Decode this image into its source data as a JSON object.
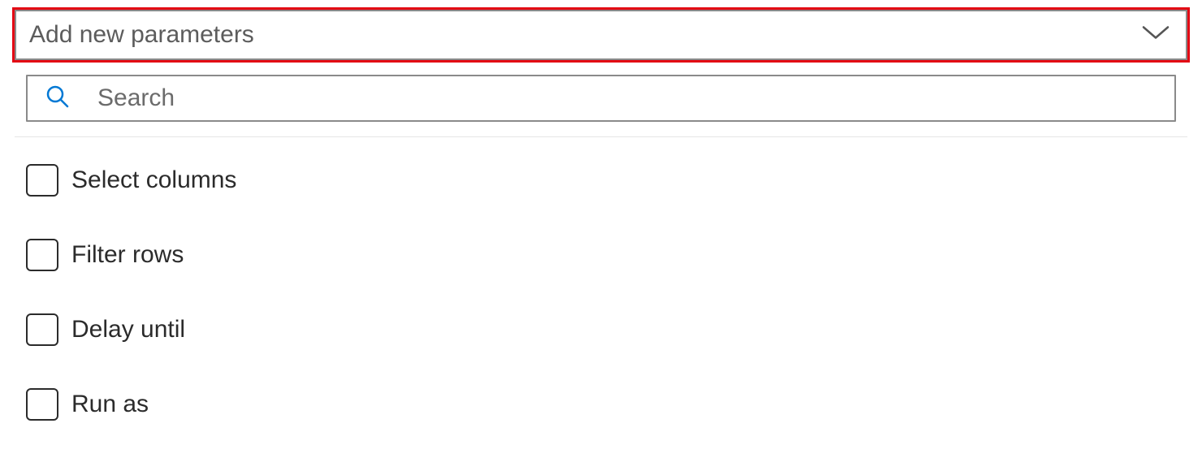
{
  "dropdown": {
    "placeholder": "Add new parameters"
  },
  "search": {
    "placeholder": "Search"
  },
  "options": [
    {
      "label": "Select columns"
    },
    {
      "label": "Filter rows"
    },
    {
      "label": "Delay until"
    },
    {
      "label": "Run as"
    }
  ]
}
